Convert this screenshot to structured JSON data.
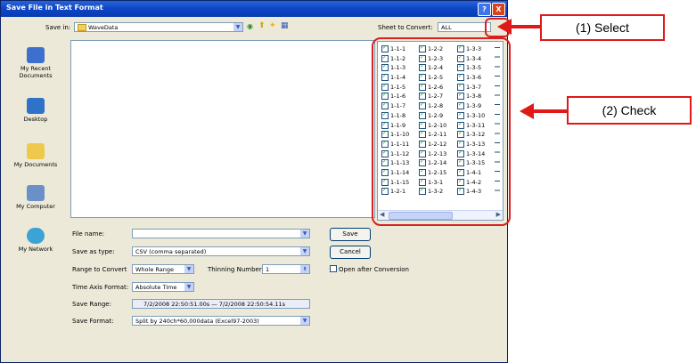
{
  "dialog": {
    "title": "Save File in Text Format",
    "help_btn": "?",
    "close_btn": "X"
  },
  "top": {
    "save_in_label": "Save in:",
    "save_in_value": "WaveData",
    "sheet_label": "Sheet to Convert:",
    "sheet_value": "ALL"
  },
  "places": [
    {
      "label": "My Recent Documents"
    },
    {
      "label": "Desktop"
    },
    {
      "label": "My Documents"
    },
    {
      "label": "My Computer"
    },
    {
      "label": "My Network"
    }
  ],
  "sheets": {
    "col1": [
      "1-1-1",
      "1-1-2",
      "1-1-3",
      "1-1-4",
      "1-1-5",
      "1-1-6",
      "1-1-7",
      "1-1-8",
      "1-1-9",
      "1-1-10",
      "1-1-11",
      "1-1-12",
      "1-1-13",
      "1-1-14",
      "1-1-15",
      "1-2-1"
    ],
    "col2": [
      "1-2-2",
      "1-2-3",
      "1-2-4",
      "1-2-5",
      "1-2-6",
      "1-2-7",
      "1-2-8",
      "1-2-9",
      "1-2-10",
      "1-2-11",
      "1-2-12",
      "1-2-13",
      "1-2-14",
      "1-2-15",
      "1-3-1",
      "1-3-2"
    ],
    "col3": [
      "1-3-3",
      "1-3-4",
      "1-3-5",
      "1-3-6",
      "1-3-7",
      "1-3-8",
      "1-3-9",
      "1-3-10",
      "1-3-11",
      "1-3-12",
      "1-3-13",
      "1-3-14",
      "1-3-15",
      "1-4-1",
      "1-4-2",
      "1-4-3"
    ]
  },
  "form": {
    "file_name_label": "File name:",
    "file_name_value": "",
    "save_type_label": "Save as type:",
    "save_type_value": "CSV (comma separated)",
    "range_label": "Range to Convert",
    "range_value": "Whole Range",
    "thinning_label": "Thinning Number:",
    "thinning_value": "1",
    "time_axis_label": "Time Axis Format:",
    "time_axis_value": "Absolute Time",
    "save_range_label": "Save Range:",
    "save_range_value": "7/2/2008 22:50:51.00s — 7/2/2008 22:50:54.11s",
    "save_format_label": "Save Format:",
    "save_format_value": "Split by 240ch*60,000data (Excel97-2003)",
    "save_btn": "Save",
    "cancel_btn": "Cancel",
    "open_after": "Open after Conversion"
  },
  "callouts": {
    "select": "(1) Select",
    "check": "(2) Check"
  },
  "colors": {
    "accent_red": "#e01818",
    "title_blue": "#0b45c6"
  }
}
